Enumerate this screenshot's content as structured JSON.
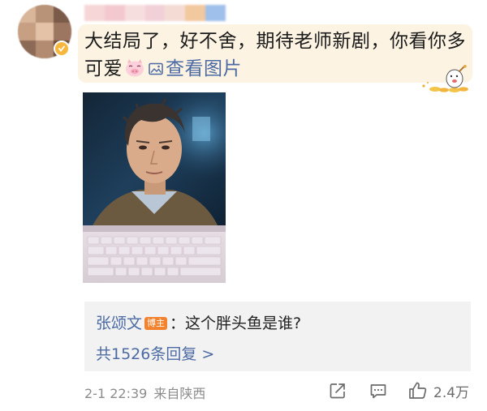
{
  "comment": {
    "text": "大结局了，好不舍，期待老师新剧，你看你多可爱",
    "view_image_label": "查看图片",
    "timestamp": "2-1 22:39",
    "location": "来自陕西",
    "like_count": "2.4万"
  },
  "reply": {
    "author": "张颂文",
    "author_badge": "博主",
    "text": "：这个胖头鱼是谁?",
    "reply_count_label": "共1526条回复 >"
  },
  "colors": {
    "link_blue": "#4b6aa4",
    "bubble_bg": "#fcf3e3",
    "reply_bg": "#f2f2f2",
    "badge_orange": "#f2822d",
    "meta_gray": "#8c8c8c"
  },
  "icons": {
    "emoji": "pig-face-emoji",
    "image": "image-icon",
    "share": "share-icon",
    "comment": "comment-icon",
    "like": "thumbs-up-icon",
    "decoration": "mascot-sticker"
  }
}
